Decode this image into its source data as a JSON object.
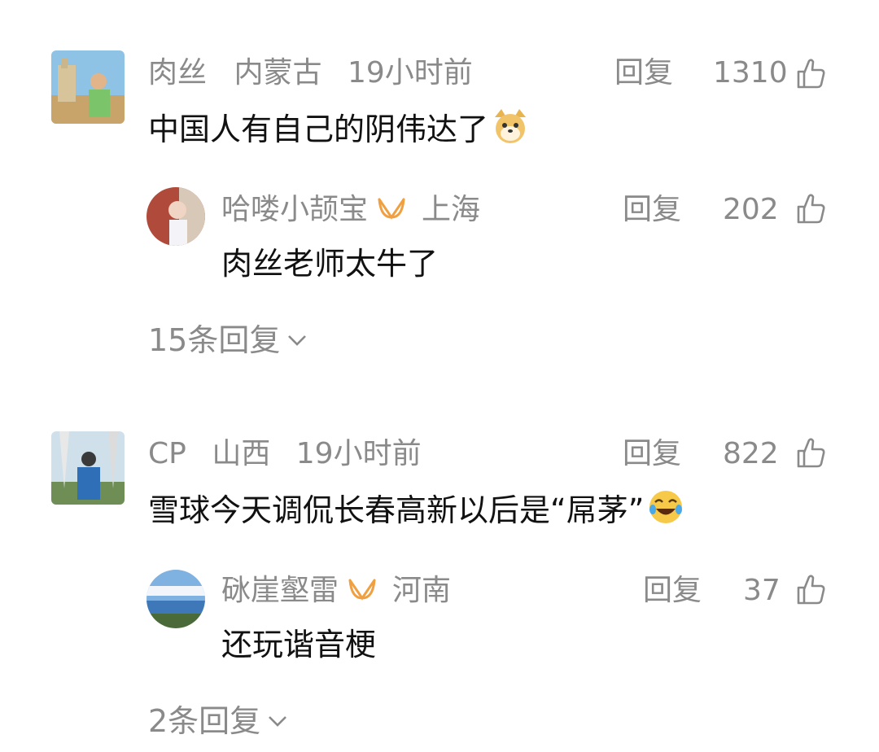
{
  "comments": [
    {
      "user": "肉丝",
      "region": "内蒙古",
      "time": "19小时前",
      "reply_label": "回复",
      "likes": "1310",
      "text": "中国人有自己的阴伟达了",
      "emoji": "doge-emoji",
      "reply": {
        "user": "哈喽小颉宝",
        "region": "上海",
        "reply_label": "回复",
        "likes": "202",
        "text": "肉丝老师太牛了"
      },
      "expand_label": "15条回复"
    },
    {
      "user": "CP",
      "region": "山西",
      "time": "19小时前",
      "reply_label": "回复",
      "likes": "822",
      "text": "雪球今天调侃长春高新以后是“屌茅”",
      "emoji": "laugh-cry-emoji",
      "reply": {
        "user": "砯崖壑雷",
        "region": "河南",
        "reply_label": "回复",
        "likes": "37",
        "text": "还玩谐音梗"
      },
      "expand_label": "2条回复"
    }
  ],
  "colors": {
    "meta": "#8a8a8a",
    "text": "#111111",
    "badge": "#f0a040"
  }
}
